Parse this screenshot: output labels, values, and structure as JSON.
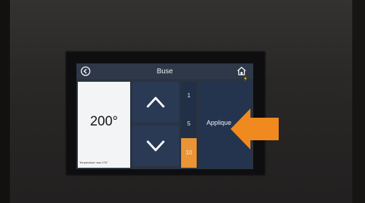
{
  "screen": {
    "title": "Buse",
    "temperature": "200°",
    "temperature_max_label": "Température max 275°",
    "steps": [
      "1",
      "5",
      "10"
    ],
    "selected_step": "10",
    "apply_label": "Applique"
  },
  "colors": {
    "accent_orange": "#eb9436",
    "pointer_orange": "#f08a1e",
    "button_navy": "#2a3a55"
  },
  "icons": [
    "back-icon",
    "home-icon",
    "chevron-up-icon",
    "chevron-down-icon",
    "spark-icon",
    "pointer-arrow-icon"
  ]
}
